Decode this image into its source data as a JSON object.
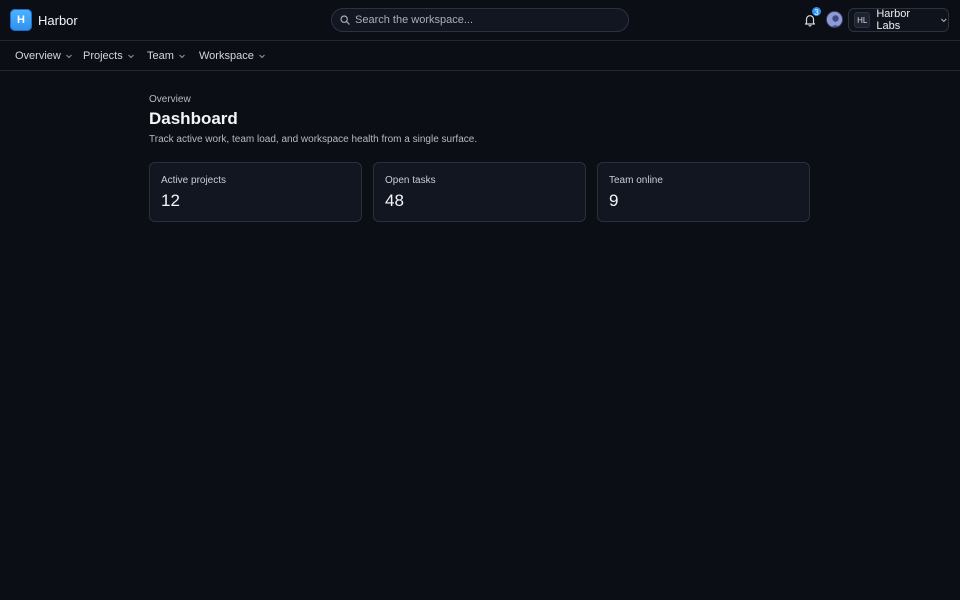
{
  "app": {
    "logo_letter": "H",
    "name": "Harbor"
  },
  "search": {
    "placeholder": "Search the workspace..."
  },
  "notifications": {
    "count": "3",
    "icon": "bell-icon"
  },
  "workspace": {
    "initials": "HL",
    "name": "Harbor Labs"
  },
  "nav": {
    "items": [
      {
        "label": "Overview"
      },
      {
        "label": "Projects"
      },
      {
        "label": "Team"
      },
      {
        "label": "Workspace"
      }
    ]
  },
  "page": {
    "eyebrow": "Overview",
    "title": "Dashboard",
    "subtitle": "Track active work, team load, and workspace health from a single surface."
  },
  "stats": [
    {
      "label": "Active projects",
      "value": "12"
    },
    {
      "label": "Open tasks",
      "value": "48"
    },
    {
      "label": "Team online",
      "value": "9"
    }
  ],
  "colors": {
    "accent": "#2f8ff0",
    "background": "#0b0e15",
    "card": "#121620",
    "border": "#2a2f3c"
  }
}
